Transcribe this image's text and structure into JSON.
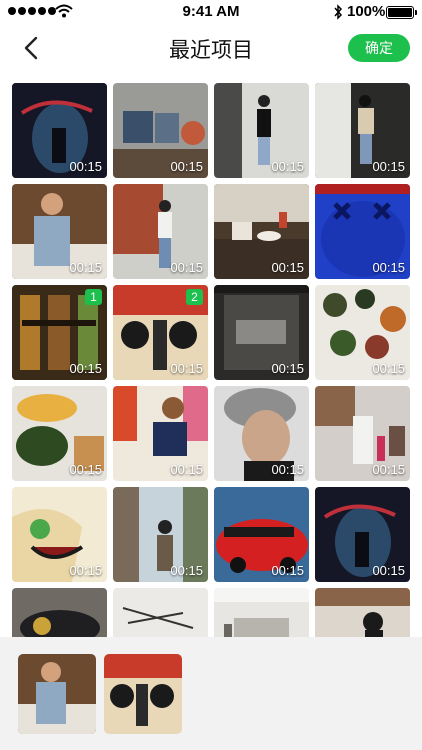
{
  "status_bar": {
    "time": "9:41 AM",
    "battery": "100%"
  },
  "nav": {
    "title": "最近项目",
    "confirm_label": "确定"
  },
  "grid": {
    "rows": [
      [
        {
          "duration": "00:15",
          "badge": ""
        },
        {
          "duration": "00:15",
          "badge": ""
        },
        {
          "duration": "00:15",
          "badge": ""
        },
        {
          "duration": "00:15",
          "badge": ""
        }
      ],
      [
        {
          "duration": "00:15",
          "badge": ""
        },
        {
          "duration": "00:15",
          "badge": ""
        },
        {
          "duration": "00:15",
          "badge": ""
        },
        {
          "duration": "00:15",
          "badge": ""
        }
      ],
      [
        {
          "duration": "00:15",
          "badge": "1"
        },
        {
          "duration": "00:15",
          "badge": "2"
        },
        {
          "duration": "00:15",
          "badge": ""
        },
        {
          "duration": "00:15",
          "badge": ""
        }
      ],
      [
        {
          "duration": "00:15",
          "badge": ""
        },
        {
          "duration": "00:15",
          "badge": ""
        },
        {
          "duration": "00:15",
          "badge": ""
        },
        {
          "duration": "00:15",
          "badge": ""
        }
      ],
      [
        {
          "duration": "00:15",
          "badge": ""
        },
        {
          "duration": "00:15",
          "badge": ""
        },
        {
          "duration": "00:15",
          "badge": ""
        },
        {
          "duration": "00:15",
          "badge": ""
        }
      ],
      [
        {
          "duration": "",
          "badge": ""
        },
        {
          "duration": "",
          "badge": ""
        },
        {
          "duration": "",
          "badge": ""
        },
        {
          "duration": "",
          "badge": ""
        }
      ]
    ]
  },
  "colors": {
    "accent": "#1dbf4d"
  }
}
